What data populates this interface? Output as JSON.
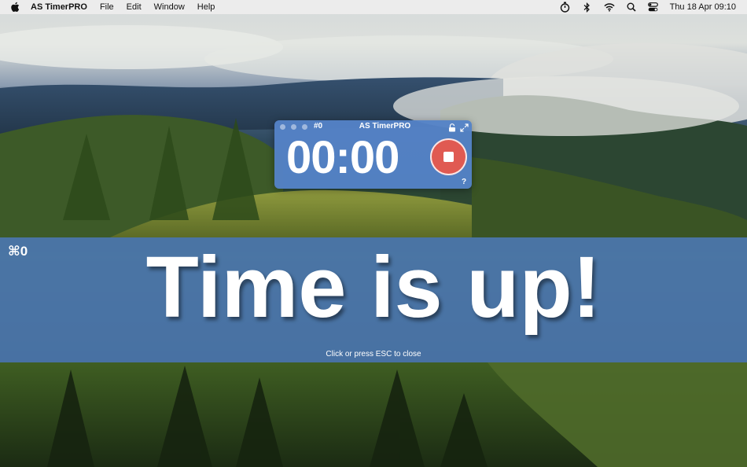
{
  "menubar": {
    "apple_icon": "apple-logo-icon",
    "app_name": "AS TimerPRO",
    "items": [
      "File",
      "Edit",
      "Window",
      "Help"
    ],
    "status_icons": [
      "timer-icon",
      "bluetooth-icon",
      "wifi-icon",
      "search-icon",
      "control-center-icon"
    ],
    "clock": "Thu 18 Apr  09:10"
  },
  "timer_window": {
    "index": "#0",
    "title": "AS TimerPRO",
    "time": "00:00",
    "help": "?",
    "stop_color": "#e05a52",
    "background_color": "#5482c7"
  },
  "alert": {
    "shortcut": "⌘0",
    "message": "Time is up!",
    "hint": "Click or press ESC to close",
    "background_color": "#4c78b2"
  }
}
